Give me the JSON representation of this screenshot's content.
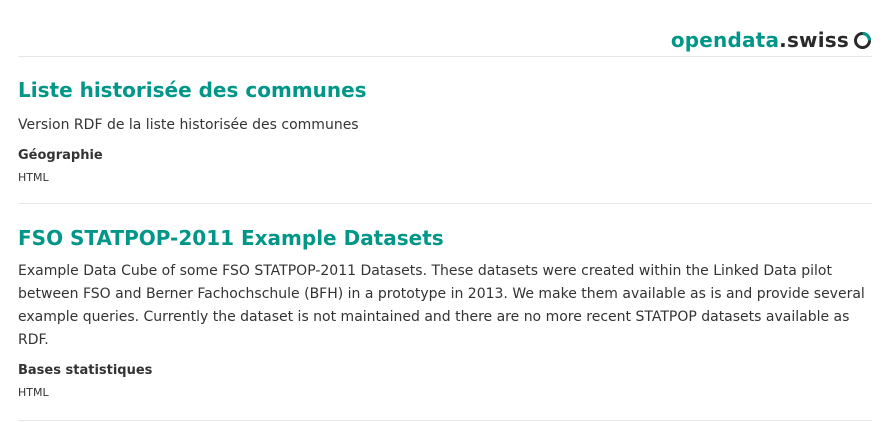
{
  "header": {
    "logo_part1": "opendata",
    "logo_part2": ".swiss",
    "accent_color": "#009688"
  },
  "datasets": [
    {
      "title": "Liste historisée des communes",
      "description": "Version RDF de la liste historisée des communes",
      "group": "Géographie",
      "format": "HTML"
    },
    {
      "title": "FSO STATPOP-2011 Example Datasets",
      "description": "Example Data Cube of some FSO STATPOP-2011 Datasets. These datasets were created within the Linked Data pilot between FSO and Berner Fachochschule (BFH) in a prototype in 2013. We make them available as is and provide several example queries. Currently the dataset is not maintained and there are no more recent STATPOP datasets available as RDF.",
      "group": "Bases statistiques",
      "format": "HTML"
    }
  ]
}
